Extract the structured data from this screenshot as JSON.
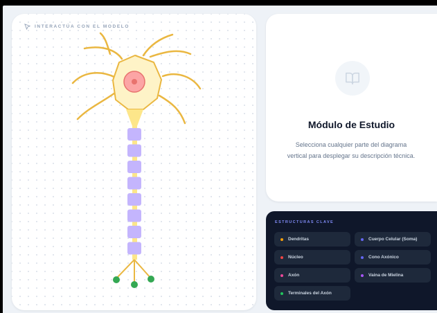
{
  "canvas": {
    "label": "INTERACTÚA CON EL MODELO",
    "icon": "cursor-pointer-icon"
  },
  "neuron": {
    "parts": [
      "dendrites",
      "soma",
      "nucleus",
      "axon-hillock",
      "myelin-sheath",
      "axon-terminals"
    ],
    "colors": {
      "dendrite": "#eab741",
      "soma_fill": "#fef3c7",
      "soma_stroke": "#eab741",
      "nucleus_fill": "#fca5a5",
      "nucleolus": "#e8726e",
      "hillock": "#fde68a",
      "myelin": "#c4b5fd",
      "terminal": "#34a853"
    },
    "myelin_segment_count": 8
  },
  "study": {
    "icon": "open-book-icon",
    "title": "Módulo de Estudio",
    "description": "Selecciona cualquier parte del diagrama vertical para desplegar su descripción técnica."
  },
  "key": {
    "title": "ESTRUCTURAS CLAVE",
    "items": [
      {
        "label": "Dendritas",
        "color": "#f59e0b"
      },
      {
        "label": "Cuerpo Celular (Soma)",
        "color": "#6366f1"
      },
      {
        "label": "Núcleo",
        "color": "#ef4444"
      },
      {
        "label": "Cono Axónico",
        "color": "#6366f1"
      },
      {
        "label": "Axón",
        "color": "#ec4899"
      },
      {
        "label": "Vaina de Mielina",
        "color": "#a855f7"
      },
      {
        "label": "Terminales del Axón",
        "color": "#22c55e"
      }
    ]
  }
}
